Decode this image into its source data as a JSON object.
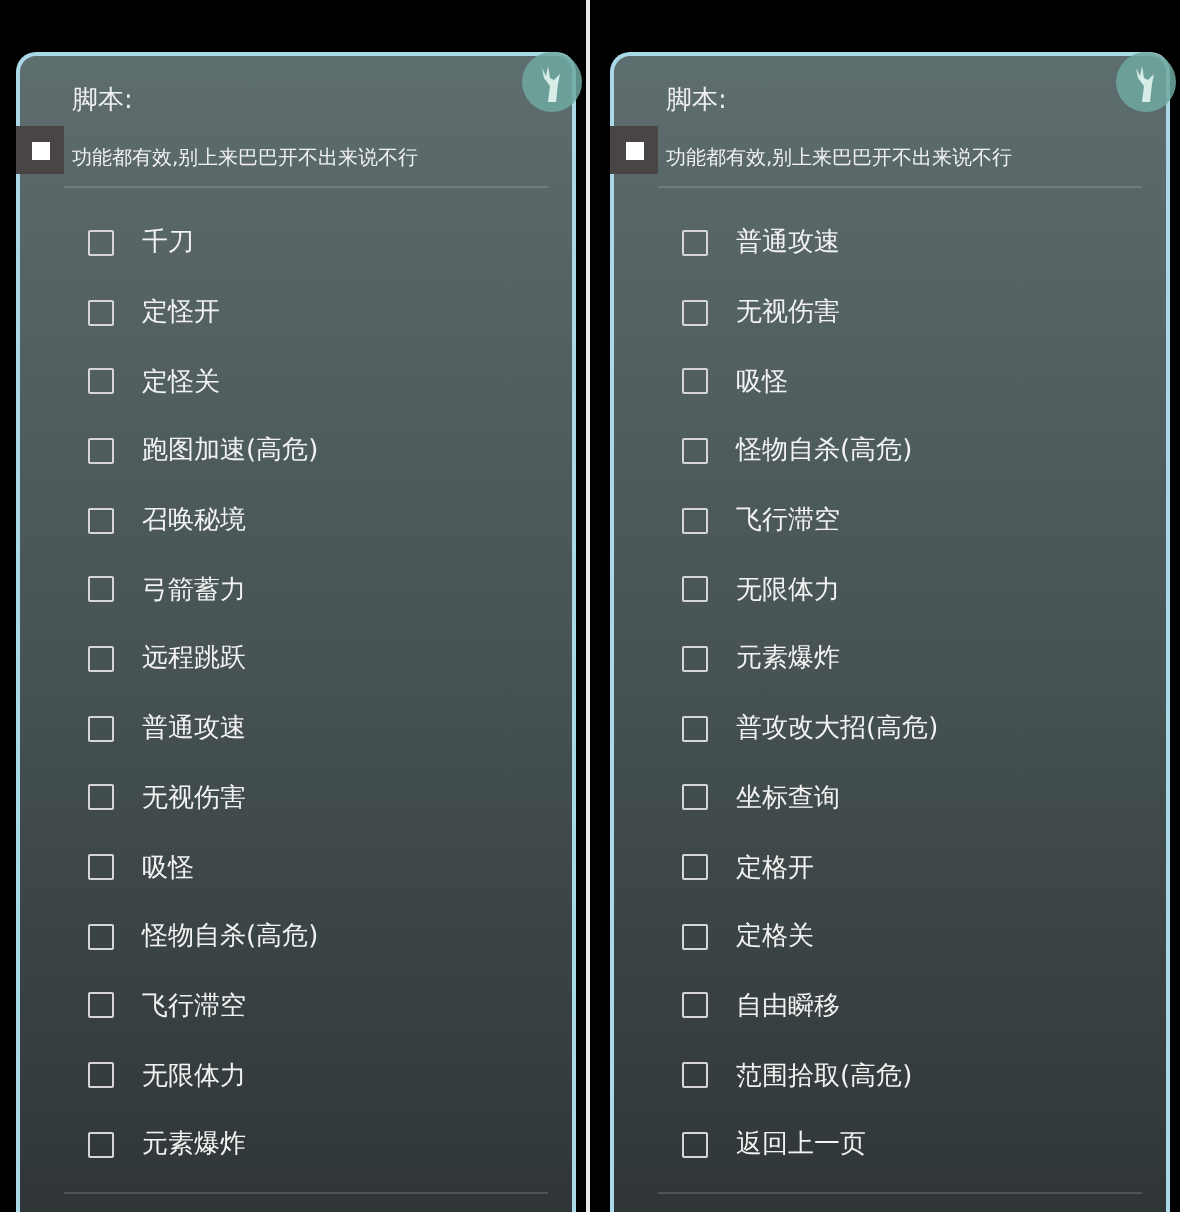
{
  "panels": [
    {
      "title": "脚本:",
      "note": "功能都有效,别上来巴巴开不出来说不行",
      "items": [
        {
          "label": "千刀",
          "checked": false
        },
        {
          "label": "定怪开",
          "checked": false
        },
        {
          "label": "定怪关",
          "checked": false
        },
        {
          "label": "跑图加速(高危)",
          "checked": false
        },
        {
          "label": "召唤秘境",
          "checked": false
        },
        {
          "label": "弓箭蓄力",
          "checked": false
        },
        {
          "label": "远程跳跃",
          "checked": false
        },
        {
          "label": "普通攻速",
          "checked": false
        },
        {
          "label": "无视伤害",
          "checked": false
        },
        {
          "label": "吸怪",
          "checked": false
        },
        {
          "label": "怪物自杀(高危)",
          "checked": false
        },
        {
          "label": "飞行滞空",
          "checked": false
        },
        {
          "label": "无限体力",
          "checked": false
        },
        {
          "label": "元素爆炸",
          "checked": false
        }
      ]
    },
    {
      "title": "脚本:",
      "note": "功能都有效,别上来巴巴开不出来说不行",
      "items": [
        {
          "label": "普通攻速",
          "checked": false
        },
        {
          "label": "无视伤害",
          "checked": false
        },
        {
          "label": "吸怪",
          "checked": false
        },
        {
          "label": "怪物自杀(高危)",
          "checked": false
        },
        {
          "label": "飞行滞空",
          "checked": false
        },
        {
          "label": "无限体力",
          "checked": false
        },
        {
          "label": "元素爆炸",
          "checked": false
        },
        {
          "label": "普攻改大招(高危)",
          "checked": false
        },
        {
          "label": "坐标查询",
          "checked": false
        },
        {
          "label": "定格开",
          "checked": false
        },
        {
          "label": "定格关",
          "checked": false
        },
        {
          "label": "自由瞬移",
          "checked": false
        },
        {
          "label": "范围拾取(高危)",
          "checked": false
        },
        {
          "label": "返回上一页",
          "checked": false
        }
      ]
    }
  ]
}
